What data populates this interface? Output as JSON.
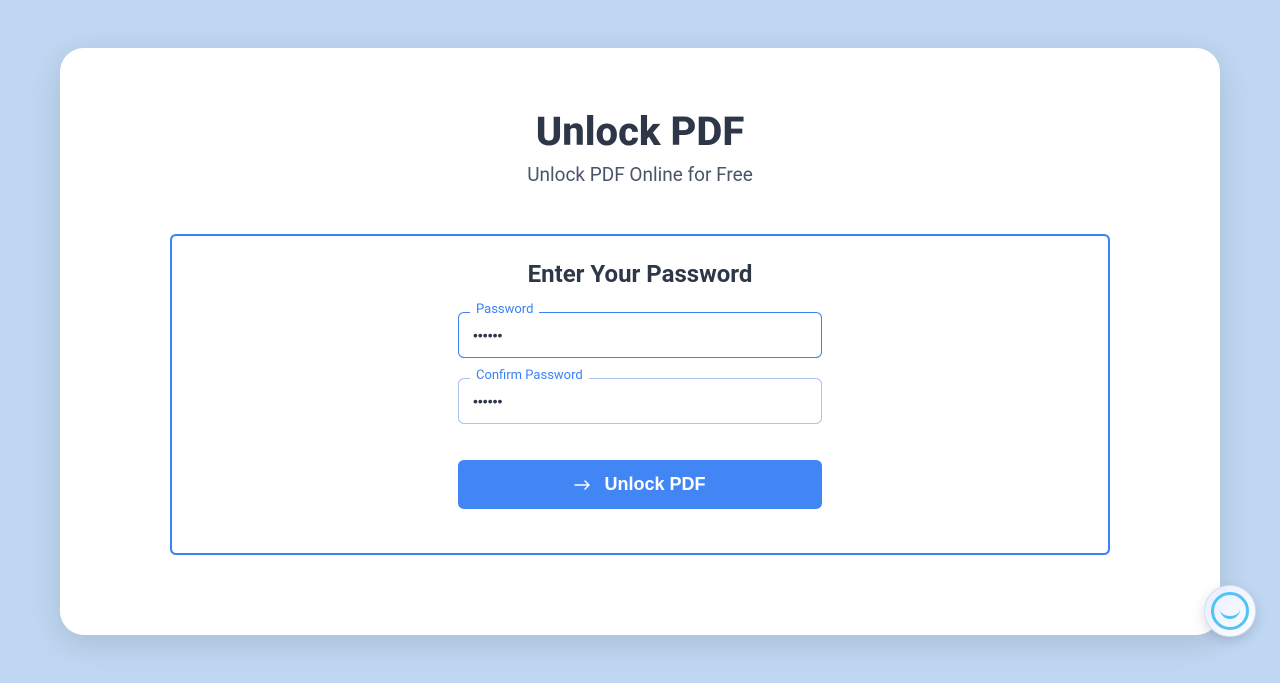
{
  "header": {
    "title": "Unlock PDF",
    "subtitle": "Unlock PDF Online for Free"
  },
  "form": {
    "title": "Enter Your Password",
    "password": {
      "label": "Password",
      "value": "••••••"
    },
    "confirmPassword": {
      "label": "Confirm Password",
      "value": "••••••"
    },
    "submitButton": {
      "label": "Unlock PDF"
    }
  },
  "colors": {
    "background": "#bfd7f2",
    "primary": "#4285f4",
    "text": "#2d3748"
  }
}
